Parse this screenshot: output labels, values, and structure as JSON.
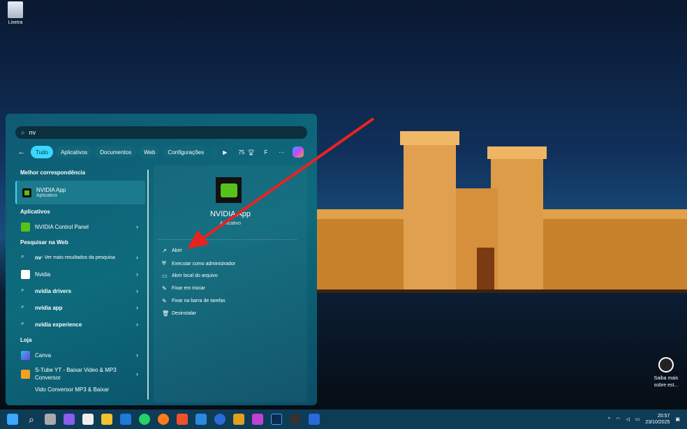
{
  "desktop": {
    "recycle_bin": "Lixeira",
    "learn_more": "Saiba mais sobre est..."
  },
  "search": {
    "query": "nv"
  },
  "tabs": [
    "Tudo",
    "Aplicativos",
    "Documentos",
    "Web",
    "Configurações"
  ],
  "toolbar": {
    "points": "75",
    "user_initial": "F",
    "more": "···"
  },
  "best_match": {
    "heading": "Melhor correspondência",
    "name": "NVIDIA App",
    "type": "Aplicativo"
  },
  "apps": {
    "heading": "Aplicativos",
    "items": [
      "NVIDIA Control Panel"
    ]
  },
  "web": {
    "heading": "Pesquisar na Web",
    "query_prefix": "nv",
    "query_suffix": " - Ver mais resultados da pesquisa",
    "items": [
      "Nvidia",
      "nvidia drivers",
      "nvidia app",
      "nvidia experience"
    ]
  },
  "store": {
    "heading": "Loja",
    "items": [
      "Canva",
      "S-Tube YT - Baixar Video & MP3 Conversor",
      "Vido Conversor MP3 & Baixar"
    ]
  },
  "detail": {
    "name": "NVIDIA App",
    "type": "Aplicativo",
    "actions": [
      "Abrir",
      "Executar como administrador",
      "Abrir local do arquivo",
      "Fixar em Iniciar",
      "Fixar na barra de tarefas",
      "Desinstalar"
    ]
  },
  "clock": {
    "time": "20:57",
    "date": "23/10/2025"
  },
  "colors": {
    "accent": "#3ad6ff",
    "arrow": "#e8231f",
    "nvidia": "#58c11a"
  }
}
